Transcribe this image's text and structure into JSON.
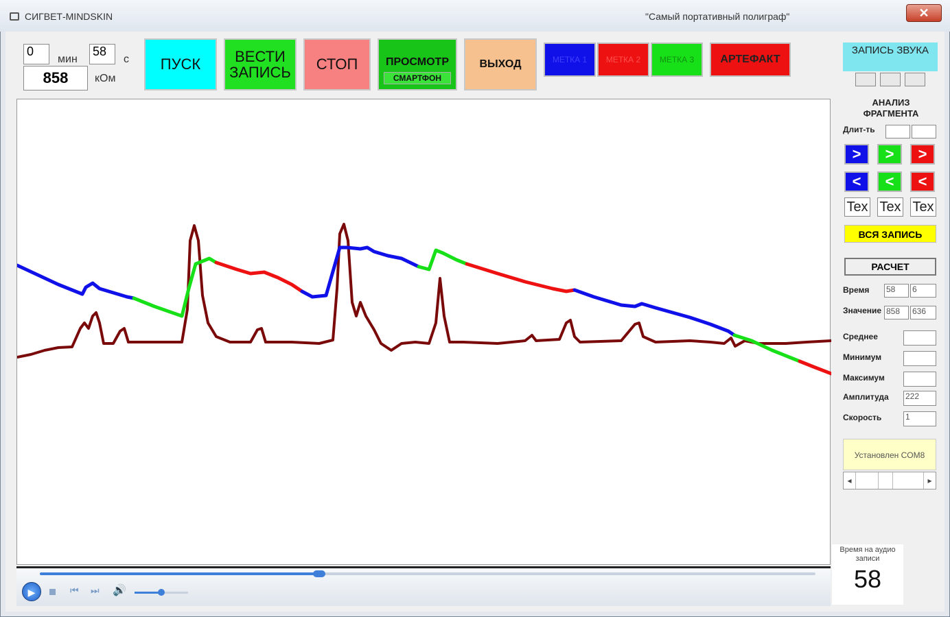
{
  "window": {
    "title": "СИГВЕТ-MINDSKIN",
    "subtitle": "\"Самый портативный полиграф\"",
    "close_label": "✕"
  },
  "timer": {
    "minutes_value": "0",
    "minutes_unit": "мин",
    "seconds_value": "58",
    "seconds_unit": "с",
    "resistance_value": "858",
    "resistance_unit": "кОм"
  },
  "toolbar": {
    "start_label": "ПУСК",
    "record_label": "ВЕСТИ ЗАПИСЬ",
    "stop_label": "СТОП",
    "view_label": "ПРОСМОТР",
    "smartphone_label": "СМАРТФОН",
    "exit_label": "ВЫХОД",
    "mark1_label": "МЕТКА 1",
    "mark2_label": "МЕТКА 2",
    "mark3_label": "МЕТКА 3",
    "artifact_label": "АРТЕФАКТ"
  },
  "colors": {
    "start": "#00ffff",
    "record": "#21e021",
    "stop": "#f78080",
    "view": "#19c419",
    "exit": "#f6c08f",
    "mark1": "#1010e8",
    "mark2": "#ee1111",
    "mark3": "#18e018",
    "artifact": "#ee1111",
    "trace_main": "#7a0a0a",
    "audio_all": "#ffff00"
  },
  "right_panel": {
    "sound_record_label": "ЗАПИСЬ ЗВУКА",
    "analysis_label": "АНАЛИЗ ФРАГМЕНТА",
    "duration_label": "Длит-ть",
    "arrow_right": ">",
    "arrow_left": "<",
    "tex_label": "Tex",
    "all_record_label": "ВСЯ ЗАПИСЬ",
    "calc_label": "РАСЧЕТ",
    "time_label": "Время",
    "time_value1": "58",
    "time_value2": "6",
    "value_label": "Значение",
    "value_value1": "858",
    "value_value2": "636",
    "mean_label": "Среднее",
    "min_label": "Минимум",
    "max_label": "Максимум",
    "amplitude_label": "Амплитуда",
    "amplitude_value": "222",
    "speed_label": "Скорость",
    "speed_value": "1",
    "com_status": "Установлен COM8",
    "scroll_left": "◂",
    "scroll_right": "▸"
  },
  "audio": {
    "time_label": "Время на аудио записи",
    "time_value": "58",
    "progress": 0.36,
    "volume": 0.5
  },
  "chart_data": {
    "type": "line",
    "series": [
      {
        "color": "#7a0a0a",
        "points": [
          [
            0,
            520
          ],
          [
            20,
            516
          ],
          [
            40,
            510
          ],
          [
            60,
            506
          ],
          [
            80,
            505
          ],
          [
            92,
            478
          ],
          [
            98,
            470
          ],
          [
            104,
            478
          ],
          [
            110,
            460
          ],
          [
            115,
            455
          ],
          [
            120,
            470
          ],
          [
            126,
            500
          ],
          [
            140,
            500
          ],
          [
            150,
            482
          ],
          [
            156,
            478
          ],
          [
            162,
            498
          ],
          [
            180,
            498
          ],
          [
            220,
            498
          ],
          [
            240,
            498
          ],
          [
            248,
            450
          ],
          [
            252,
            350
          ],
          [
            258,
            328
          ],
          [
            264,
            350
          ],
          [
            270,
            430
          ],
          [
            278,
            470
          ],
          [
            290,
            490
          ],
          [
            310,
            498
          ],
          [
            340,
            498
          ],
          [
            350,
            480
          ],
          [
            356,
            478
          ],
          [
            362,
            498
          ],
          [
            400,
            498
          ],
          [
            440,
            500
          ],
          [
            460,
            495
          ],
          [
            466,
            420
          ],
          [
            470,
            340
          ],
          [
            476,
            326
          ],
          [
            482,
            350
          ],
          [
            488,
            440
          ],
          [
            494,
            460
          ],
          [
            500,
            440
          ],
          [
            508,
            460
          ],
          [
            520,
            480
          ],
          [
            530,
            500
          ],
          [
            545,
            510
          ],
          [
            560,
            500
          ],
          [
            580,
            498
          ],
          [
            600,
            500
          ],
          [
            610,
            470
          ],
          [
            616,
            405
          ],
          [
            622,
            460
          ],
          [
            630,
            498
          ],
          [
            650,
            498
          ],
          [
            700,
            500
          ],
          [
            740,
            496
          ],
          [
            750,
            488
          ],
          [
            756,
            496
          ],
          [
            790,
            494
          ],
          [
            800,
            470
          ],
          [
            806,
            466
          ],
          [
            812,
            490
          ],
          [
            820,
            498
          ],
          [
            880,
            496
          ],
          [
            900,
            472
          ],
          [
            906,
            470
          ],
          [
            912,
            490
          ],
          [
            930,
            498
          ],
          [
            980,
            496
          ],
          [
            1010,
            498
          ],
          [
            1030,
            500
          ],
          [
            1040,
            492
          ],
          [
            1046,
            504
          ],
          [
            1060,
            496
          ],
          [
            1080,
            500
          ],
          [
            1120,
            500
          ],
          [
            1150,
            498
          ],
          [
            1186,
            496
          ]
        ]
      },
      {
        "color": "#1010e8",
        "points": [
          [
            0,
            386
          ],
          [
            30,
            400
          ],
          [
            60,
            414
          ],
          [
            95,
            428
          ],
          [
            100,
            418
          ],
          [
            110,
            412
          ],
          [
            120,
            420
          ],
          [
            140,
            426
          ],
          [
            160,
            432
          ],
          [
            170,
            434
          ]
        ]
      },
      {
        "color": "#18e018",
        "points": [
          [
            170,
            434
          ],
          [
            200,
            446
          ],
          [
            240,
            460
          ],
          [
            250,
            420
          ],
          [
            260,
            384
          ],
          [
            270,
            380
          ],
          [
            280,
            376
          ],
          [
            290,
            382
          ]
        ]
      },
      {
        "color": "#ee1111",
        "points": [
          [
            290,
            382
          ],
          [
            320,
            392
          ],
          [
            340,
            398
          ],
          [
            360,
            396
          ],
          [
            380,
            404
          ],
          [
            400,
            414
          ],
          [
            415,
            424
          ]
        ]
      },
      {
        "color": "#1010e8",
        "points": [
          [
            415,
            424
          ],
          [
            430,
            432
          ],
          [
            450,
            430
          ],
          [
            470,
            360
          ],
          [
            480,
            360
          ],
          [
            500,
            362
          ],
          [
            510,
            360
          ],
          [
            520,
            366
          ],
          [
            540,
            372
          ],
          [
            560,
            376
          ],
          [
            585,
            388
          ]
        ]
      },
      {
        "color": "#18e018",
        "points": [
          [
            585,
            388
          ],
          [
            600,
            392
          ],
          [
            610,
            364
          ],
          [
            620,
            368
          ],
          [
            640,
            378
          ],
          [
            655,
            384
          ]
        ]
      },
      {
        "color": "#ee1111",
        "points": [
          [
            655,
            384
          ],
          [
            700,
            398
          ],
          [
            740,
            410
          ],
          [
            780,
            420
          ],
          [
            800,
            424
          ],
          [
            812,
            422
          ]
        ]
      },
      {
        "color": "#1010e8",
        "points": [
          [
            812,
            422
          ],
          [
            840,
            432
          ],
          [
            880,
            444
          ],
          [
            900,
            446
          ],
          [
            910,
            442
          ],
          [
            930,
            448
          ],
          [
            980,
            462
          ],
          [
            1010,
            472
          ],
          [
            1036,
            482
          ],
          [
            1045,
            488
          ]
        ]
      },
      {
        "color": "#18e018",
        "points": [
          [
            1045,
            488
          ],
          [
            1070,
            496
          ],
          [
            1100,
            510
          ],
          [
            1130,
            522
          ],
          [
            1140,
            526
          ]
        ]
      },
      {
        "color": "#ee1111",
        "points": [
          [
            1140,
            526
          ],
          [
            1160,
            534
          ],
          [
            1186,
            544
          ]
        ]
      }
    ]
  }
}
